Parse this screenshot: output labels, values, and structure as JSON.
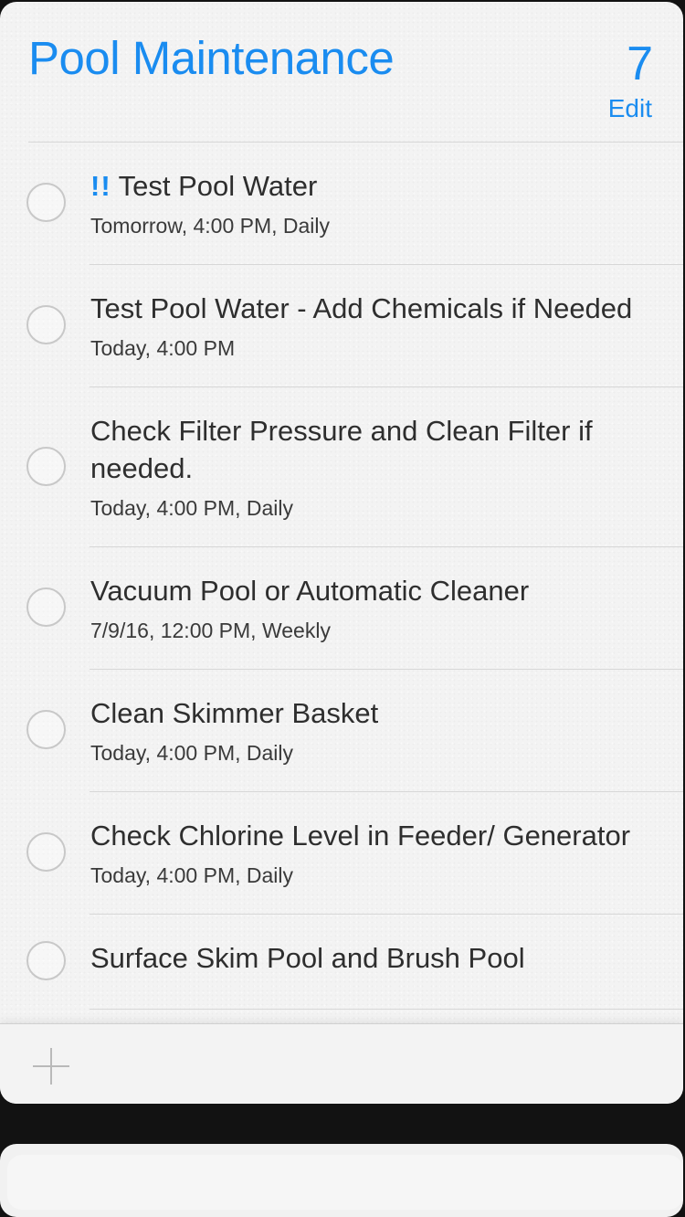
{
  "list": {
    "title": "Pool Maintenance",
    "count": "7",
    "edit_label": "Edit",
    "accent_color": "#1a8cf0"
  },
  "reminders": [
    {
      "priority": "!!",
      "title": "Test Pool Water",
      "subtitle": "Tomorrow, 4:00 PM, Daily"
    },
    {
      "title": "Test Pool Water - Add Chemicals if Needed",
      "subtitle": "Today, 4:00 PM"
    },
    {
      "title": "Check Filter Pressure and Clean Filter if needed.",
      "subtitle": "Today, 4:00 PM, Daily"
    },
    {
      "title": "Vacuum Pool or Automatic Cleaner",
      "subtitle": "7/9/16, 12:00 PM, Weekly"
    },
    {
      "title": "Clean Skimmer Basket",
      "subtitle": "Today, 4:00 PM, Daily"
    },
    {
      "title": "Check Chlorine Level in Feeder/ Generator",
      "subtitle": "Today, 4:00 PM, Daily"
    },
    {
      "title": "Surface Skim Pool and Brush Pool",
      "subtitle": ""
    }
  ],
  "footer": {
    "add_icon": "plus-icon"
  }
}
